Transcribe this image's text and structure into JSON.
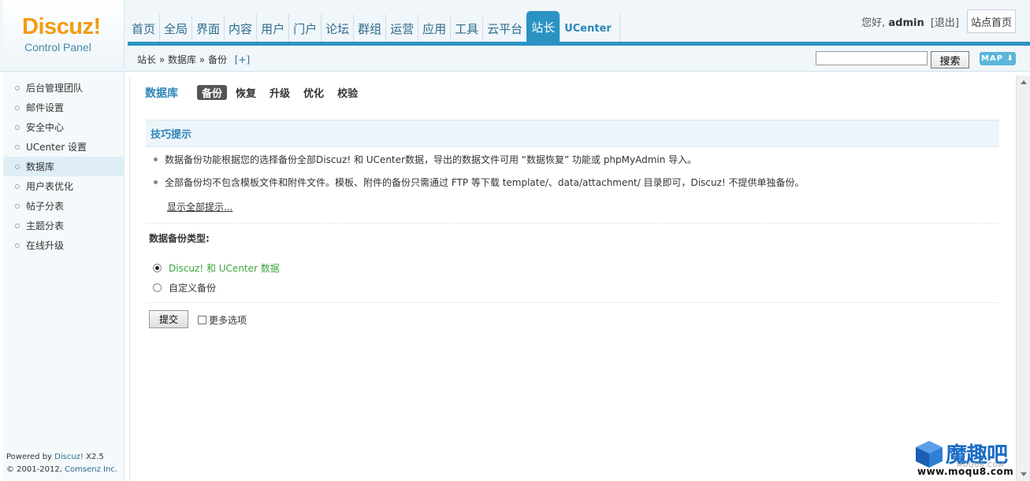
{
  "logo": {
    "brand": "Discuz!",
    "subtitle": "Control Panel"
  },
  "nav": {
    "items": [
      "首页",
      "全局",
      "界面",
      "内容",
      "用户",
      "门户",
      "论坛",
      "群组",
      "运营",
      "应用",
      "工具",
      "云平台",
      "站长",
      "UCenter"
    ],
    "active": "站长"
  },
  "user": {
    "greeting": "您好,",
    "name": "admin",
    "logout": "[退出]",
    "site_home": "站点首页"
  },
  "breadcrumb": {
    "text": "站长 » 数据库 » 备份",
    "plus": "[+]"
  },
  "search": {
    "button": "搜索",
    "value": ""
  },
  "map_button": "MAP ⬇",
  "sidebar": {
    "items": [
      "后台管理团队",
      "邮件设置",
      "安全中心",
      "UCenter 设置",
      "数据库",
      "用户表优化",
      "帖子分表",
      "主题分表",
      "在线升级"
    ],
    "active": "数据库",
    "footer_line1_prefix": "Powered by ",
    "footer_line1_link": "Discuz!",
    "footer_line1_suffix": " X2.5",
    "footer_line2_prefix": "© 2001-2012, ",
    "footer_line2_link": "Comsenz Inc."
  },
  "main": {
    "title": "数据库",
    "subtabs": [
      "备份",
      "恢复",
      "升级",
      "优化",
      "校验"
    ],
    "active_subtab": "备份",
    "tips_title": "技巧提示",
    "tips": [
      "数据备份功能根据您的选择备份全部Discuz! 和 UCenter数据，导出的数据文件可用 “数据恢复” 功能或 phpMyAdmin 导入。",
      "全部备份均不包含模板文件和附件文件。模板、附件的备份只需通过 FTP 等下载 template/、data/attachment/ 目录即可，Discuz! 不提供单独备份。"
    ],
    "show_all": "显示全部提示...",
    "backup_type_label": "数据备份类型:",
    "options": [
      {
        "label": "Discuz! 和 UCenter 数据",
        "checked": true
      },
      {
        "label": "自定义备份",
        "checked": false
      }
    ],
    "submit": "提交",
    "more_options": "更多选项"
  },
  "watermark": {
    "text": "魔趣吧",
    "sub": "MOQU8.COM",
    "url": "www.moqu8.com"
  },
  "colors": {
    "accent": "#2b93c4",
    "logo": "#f29b12",
    "link": "#2d86b8",
    "checked_option": "#3aa53a"
  }
}
